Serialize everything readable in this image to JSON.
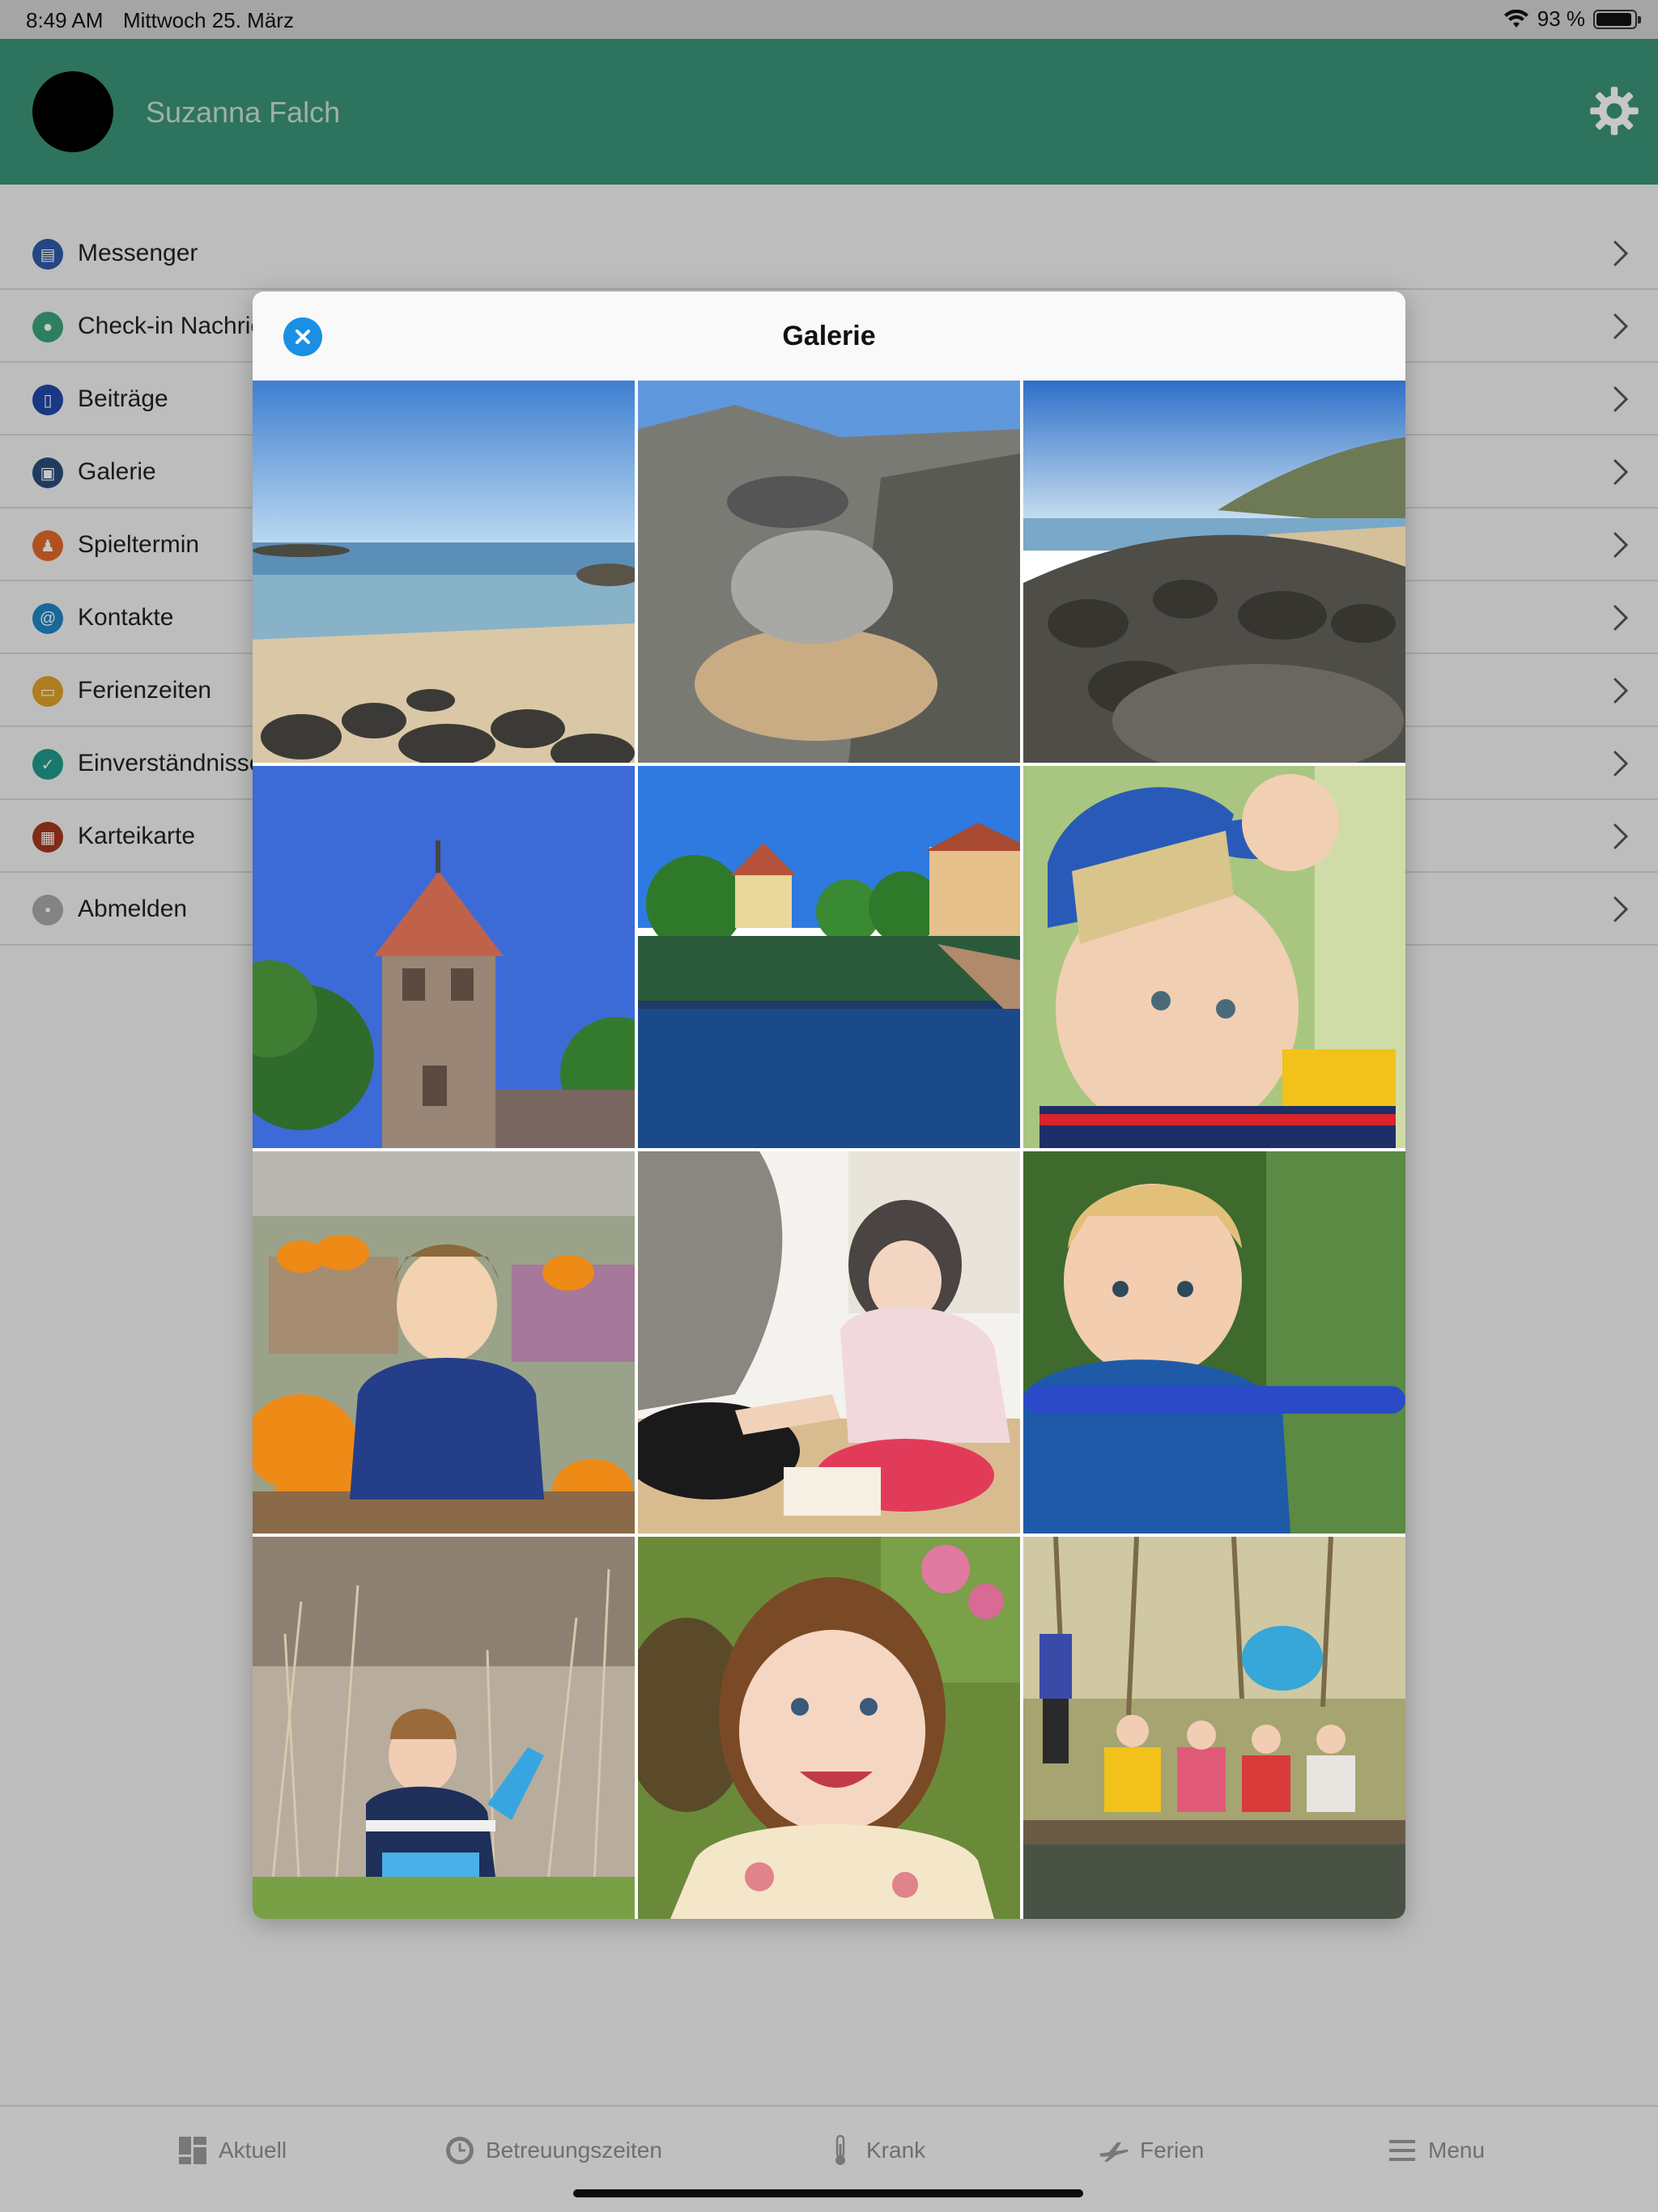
{
  "status_bar": {
    "time": "8:49 AM",
    "date": "Mittwoch 25. März",
    "battery": "93 %",
    "battery_level": 0.93
  },
  "header": {
    "user_name": "Suzanna Falch",
    "settings_icon": "gear-icon"
  },
  "menu": {
    "items": [
      {
        "label": "Messenger",
        "icon": "messenger-icon",
        "color": "#2f5aa8"
      },
      {
        "label": "Check-in Nachric",
        "icon": "chat-bubble-icon",
        "color": "#3aa57a"
      },
      {
        "label": "Beiträge",
        "icon": "clipboard-icon",
        "color": "#2048a8"
      },
      {
        "label": "Galerie",
        "icon": "gallery-icon",
        "color": "#2a4c7a"
      },
      {
        "label": "Spieltermin",
        "icon": "play-date-icon",
        "color": "#e06a2a"
      },
      {
        "label": "Kontakte",
        "icon": "at-sign-icon",
        "color": "#1f86c4"
      },
      {
        "label": "Ferienzeiten",
        "icon": "holiday-icon",
        "color": "#e0a22a"
      },
      {
        "label": "Einverständnisse",
        "icon": "thumbs-up-icon",
        "color": "#1f9a8a"
      },
      {
        "label": "Karteikarte",
        "icon": "card-icon",
        "color": "#a5381f"
      },
      {
        "label": "Abmelden",
        "icon": "lock-icon",
        "color": "#a8a8a8"
      }
    ]
  },
  "modal": {
    "title": "Galerie",
    "close_icon": "close-icon",
    "photos": [
      {
        "subject": "beach shoreline with rocks"
      },
      {
        "subject": "stacked stones"
      },
      {
        "subject": "rocky coast with cliffs"
      },
      {
        "subject": "medieval stone tower"
      },
      {
        "subject": "river with old town houses"
      },
      {
        "subject": "toddler in blue cap"
      },
      {
        "subject": "boy among pumpkins"
      },
      {
        "subject": "girl playing with adult"
      },
      {
        "subject": "smiling blond boy"
      },
      {
        "subject": "boy in tall grass"
      },
      {
        "subject": "smiling girl with flowers"
      },
      {
        "subject": "children on wooden bridge"
      }
    ]
  },
  "tabbar": {
    "tabs": [
      {
        "label": "Aktuell",
        "icon": "dashboard-icon"
      },
      {
        "label": "Betreuungszeiten",
        "icon": "clock-icon"
      },
      {
        "label": "Krank",
        "icon": "thermometer-icon"
      },
      {
        "label": "Ferien",
        "icon": "airplane-icon"
      },
      {
        "label": "Menu",
        "icon": "hamburger-icon"
      }
    ]
  }
}
